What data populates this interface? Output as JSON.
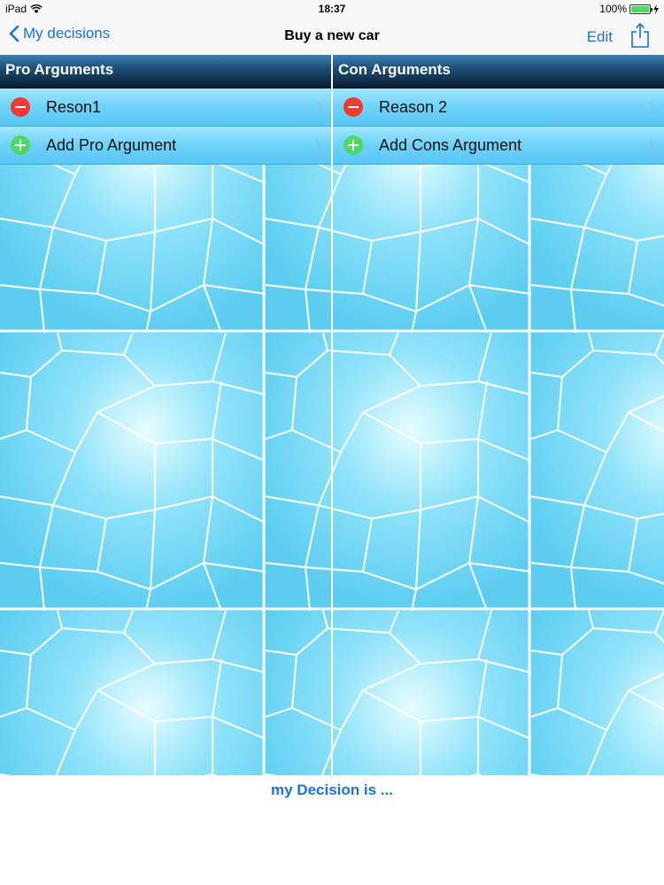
{
  "status": {
    "device": "iPad",
    "time": "18:37",
    "battery": "100%"
  },
  "nav": {
    "back_label": "My decisions",
    "title": "Buy a new car",
    "edit_label": "Edit"
  },
  "pro": {
    "header": "Pro Arguments",
    "items": [
      {
        "label": "Reson1"
      }
    ],
    "add_label": "Add Pro Argument"
  },
  "con": {
    "header": "Con Arguments",
    "items": [
      {
        "label": "Reason 2"
      }
    ],
    "add_label": "Add Cons Argument"
  },
  "decision": {
    "label": "my Decision is ..."
  },
  "colors": {
    "accent": "#1a73d9",
    "delete": "#ee3b32",
    "add": "#4cd964",
    "header": "#1d4f7a",
    "row": "#6fd3fa"
  }
}
